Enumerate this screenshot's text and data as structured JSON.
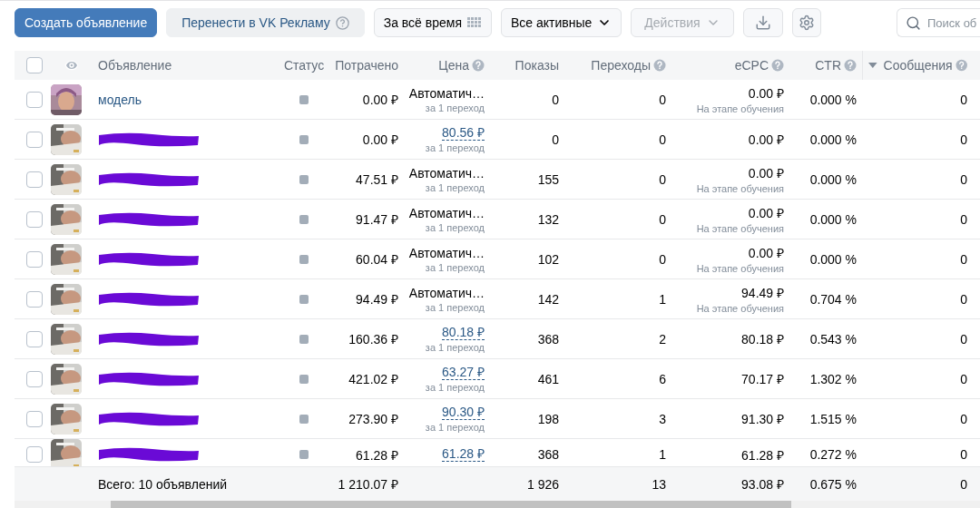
{
  "toolbar": {
    "create_button": "Создать объявление",
    "transfer_button": {
      "label": "Перенести в VK Рекламу",
      "help": true
    },
    "period": "За всё время",
    "filter": "Все активные",
    "actions": {
      "label": "Действия",
      "disabled": true
    },
    "search": {
      "placeholder": "Поиск об"
    }
  },
  "table": {
    "header_checkbox": {
      "checked": false
    },
    "columns": [
      {
        "label": "Объявление",
        "help": false,
        "sorted": false
      },
      {
        "label": "Статус",
        "help": false,
        "sorted": false
      },
      {
        "label": "Потрачено",
        "help": false,
        "sorted": false
      },
      {
        "label": "Цена",
        "help": true,
        "sorted": false
      },
      {
        "label": "Показы",
        "help": false,
        "sorted": false
      },
      {
        "label": "Переходы",
        "help": true,
        "sorted": false
      },
      {
        "label": "eCPC",
        "help": true,
        "sorted": false
      },
      {
        "label": "CTR",
        "help": true,
        "sorted": false
      },
      {
        "label": "Сообщения",
        "help": true,
        "sorted": true
      }
    ],
    "rows": [
      {
        "checked": false,
        "name": "модель",
        "name_redacted": false,
        "spent": "0.00 ₽",
        "price": {
          "kind": "auto",
          "value": "Автоматич…",
          "sub": "за 1 переход"
        },
        "shows": "0",
        "clicks": "0",
        "ecpc": "0.00 ₽",
        "ecpc_sub": "На этапе обучения",
        "ctr": "0.000 %",
        "messages": "0"
      },
      {
        "checked": false,
        "name_redacted": true,
        "spent": "0.00 ₽",
        "price": {
          "kind": "link",
          "value": "80.56 ₽",
          "sub": "за 1 переход"
        },
        "shows": "0",
        "clicks": "0",
        "ecpc": "0.00 ₽",
        "ctr": "0.000 %",
        "messages": "0"
      },
      {
        "checked": false,
        "name_redacted": true,
        "spent": "47.51 ₽",
        "price": {
          "kind": "auto",
          "value": "Автоматич…",
          "sub": "за 1 переход"
        },
        "shows": "155",
        "clicks": "0",
        "ecpc": "0.00 ₽",
        "ecpc_sub": "На этапе обучения",
        "ctr": "0.000 %",
        "messages": "0"
      },
      {
        "checked": false,
        "name_redacted": true,
        "spent": "91.47 ₽",
        "price": {
          "kind": "auto",
          "value": "Автоматич…",
          "sub": "за 1 переход"
        },
        "shows": "132",
        "clicks": "0",
        "ecpc": "0.00 ₽",
        "ecpc_sub": "На этапе обучения",
        "ctr": "0.000 %",
        "messages": "0"
      },
      {
        "checked": false,
        "name_redacted": true,
        "spent": "60.04 ₽",
        "price": {
          "kind": "auto",
          "value": "Автоматич…",
          "sub": "за 1 переход"
        },
        "shows": "102",
        "clicks": "0",
        "ecpc": "0.00 ₽",
        "ecpc_sub": "На этапе обучения",
        "ctr": "0.000 %",
        "messages": "0"
      },
      {
        "checked": false,
        "name_redacted": true,
        "spent": "94.49 ₽",
        "price": {
          "kind": "auto",
          "value": "Автоматич…",
          "sub": "за 1 переход"
        },
        "shows": "142",
        "clicks": "1",
        "ecpc": "94.49 ₽",
        "ecpc_sub": "На этапе обучения",
        "ctr": "0.704 %",
        "messages": "0"
      },
      {
        "checked": false,
        "name_redacted": true,
        "spent": "160.36 ₽",
        "price": {
          "kind": "link",
          "value": "80.18 ₽",
          "sub": "за 1 переход"
        },
        "shows": "368",
        "clicks": "2",
        "ecpc": "80.18 ₽",
        "ctr": "0.543 %",
        "messages": "0"
      },
      {
        "checked": false,
        "name_redacted": true,
        "spent": "421.02 ₽",
        "price": {
          "kind": "link",
          "value": "63.27 ₽",
          "sub": "за 1 переход"
        },
        "shows": "461",
        "clicks": "6",
        "ecpc": "70.17 ₽",
        "ctr": "1.302 %",
        "messages": "0"
      },
      {
        "checked": false,
        "name_redacted": true,
        "spent": "273.90 ₽",
        "price": {
          "kind": "link",
          "value": "90.30 ₽",
          "sub": "за 1 переход"
        },
        "shows": "198",
        "clicks": "3",
        "ecpc": "91.30 ₽",
        "ctr": "1.515 %",
        "messages": "0"
      },
      {
        "checked": false,
        "name_redacted": true,
        "spent": "61.28 ₽",
        "price": {
          "kind": "link",
          "value": "61.28 ₽"
        },
        "shows": "368",
        "clicks": "1",
        "ecpc": "61.28 ₽",
        "ctr": "0.272 %",
        "messages": "0"
      }
    ],
    "total": {
      "label": "Всего: 10 объявлений",
      "spent": "1 210.07 ₽",
      "shows": "1 926",
      "clicks": "13",
      "ecpc": "93.08 ₽",
      "ctr": "0.675 %",
      "messages": "0"
    }
  }
}
